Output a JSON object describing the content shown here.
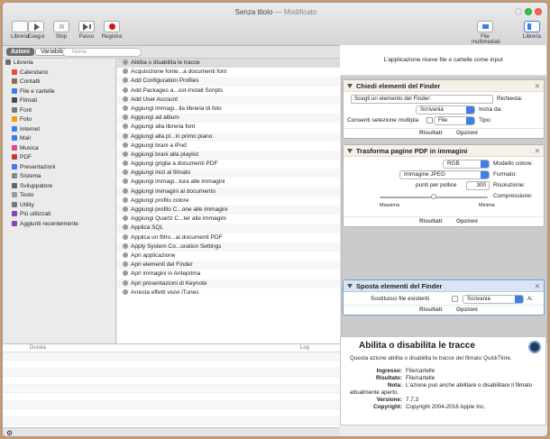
{
  "window": {
    "title": "Senza titolo",
    "title_suffix": "— Modificato"
  },
  "toolbar": {
    "left": [
      {
        "label": "Libreria",
        "icon": "sidebar-icon"
      },
      {
        "label": "Registra",
        "icon": "record-icon"
      },
      {
        "label": "Stop",
        "icon": "stop-icon"
      },
      {
        "label": "Esegui",
        "icon": "play-icon"
      }
    ],
    "right": [
      {
        "label": "Passo",
        "icon": "step-icon"
      },
      {
        "label": "Libreria",
        "icon": "sidebar-icon"
      },
      {
        "label": "File multimediali",
        "icon": "media-icon"
      }
    ]
  },
  "library": {
    "tab_actions": "Azioni",
    "tab_variables": "Variabili",
    "search_placeholder": "Nome"
  },
  "categories": [
    "Libreria",
    "Calendario",
    "Contatti",
    "File e cartelle",
    "Filmati",
    "Font",
    "Foto",
    "Internet",
    "Mail",
    "Musica",
    "PDF",
    "Presentazioni",
    "Sistema",
    "Sviluppatore",
    "Testo",
    "Utility",
    "Più utilizzati",
    "Aggiunti recentemente"
  ],
  "actions": [
    "Abilita o disabilita le tracce",
    "Acquisizione fonte...a documenti font",
    "Add Configuration Profiles",
    "Add Packages a...ost-Install Scripts",
    "Add User Account",
    "Aggiungi immagi...lla libreria di foto",
    "Aggiungi ad album",
    "Aggiungi alla libreria font",
    "Aggiungi alla pl...in primo piano",
    "Aggiungi brani a iPod",
    "Aggiungi brani alla playlist",
    "Aggiungi griglia a documenti PDF",
    "Aggiungi inizi al filmato",
    "Aggiungi immagi...tura alle immagini",
    "Aggiungi immagini al documento",
    "Aggiungi profilo colore",
    "Aggiungi profilo C...one alle immagini",
    "Aggiungi Quartz C...ter alle immagini",
    "Applica SQL",
    "Applica un filtro...ai documenti PDF",
    "Apply System Co...uration Settings",
    "Apri applicazione",
    "Apri elementi del Finder",
    "Apri immagini in Anteprima",
    "Apri presentazioni di Keynote",
    "Arresta effetti visivi iTunes"
  ],
  "description": {
    "title": "Abilita o disabilita le tracce",
    "text": "Questa azione abilita o disabilita le tracce del filmato QuickTime.",
    "fields": [
      {
        "k": "Ingresso:",
        "v": "File/cartelle"
      },
      {
        "k": "Risultato:",
        "v": "File/cartelle"
      },
      {
        "k": "Nota:",
        "v": "L'azione può anche abilitare o disabilitare il filmato attualmente aperto."
      },
      {
        "k": "Versione:",
        "v": "7.7.3"
      },
      {
        "k": "Copyright:",
        "v": "Copyright 2004-2016 Apple Inc."
      }
    ]
  },
  "workflow": {
    "input_note": "L'applicazione riceve file e cartelle come input",
    "footer_results": "Risultati",
    "footer_options": "Opzioni",
    "actions": [
      {
        "title": "Chiedi elementi del Finder",
        "richiesta_label": "Richiesta:",
        "richiesta_value": "Scegli un elemento del Finder:",
        "inizia_label": "Inizia da:",
        "inizia_value": "Scrivania",
        "tipo_label": "Tipo:",
        "tipo_value": "File",
        "multi_label": "Consenti selezione multipla"
      },
      {
        "title": "Trasforma pagine PDF in immagini",
        "modello_label": "Modello colore:",
        "modello_value": "RGB",
        "formato_label": "Formato:",
        "formato_value": "Immagine JPEG",
        "risoluzione_label": "Risoluzione:",
        "risoluzione_value": "300",
        "risoluzione_unit": "punti per pollice",
        "compressione_label": "Compressione:",
        "min_label": "Minima",
        "max_label": "Massima",
        "compressione_level": 0.5
      },
      {
        "title": "Sposta elementi del Finder",
        "a_label": "A:",
        "a_value": "Scrivania",
        "replace_label": "Sostituisci file esistenti"
      }
    ]
  },
  "log": {
    "col_log": "Log",
    "col_duration": "Durata"
  },
  "colors": {
    "accent": "#3f7ee6",
    "record": "#d01818",
    "selected_header": "#d9e4f5"
  }
}
